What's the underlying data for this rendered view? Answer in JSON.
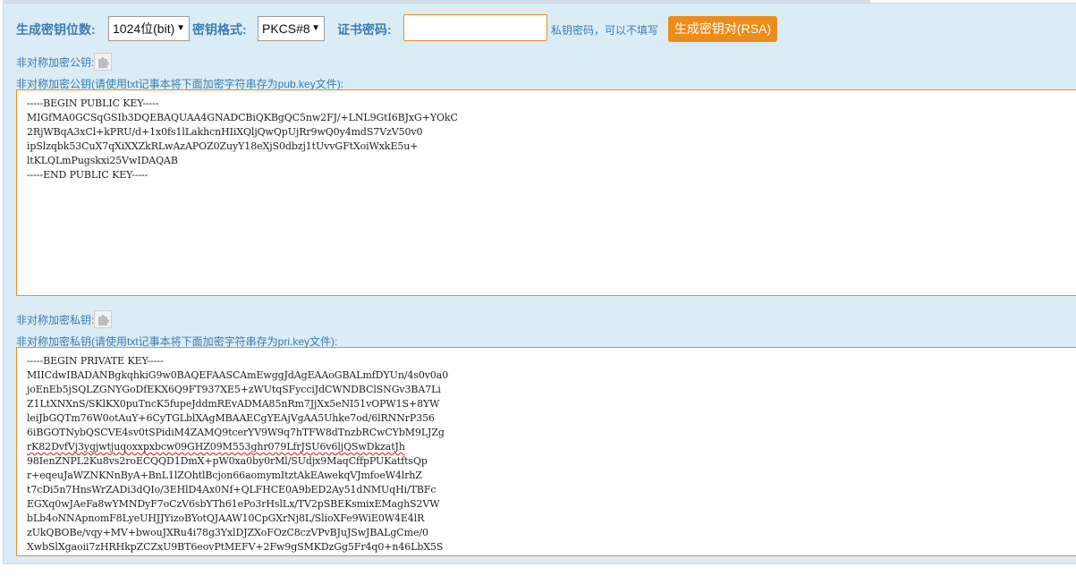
{
  "form": {
    "bits_label": "生成密钥位数:",
    "bits_value": "1024位(bit)",
    "format_label": "密钥格式:",
    "format_value": "PKCS#8",
    "password_label": "证书密码:",
    "password_value": "",
    "password_hint": "私钥密码，可以不填写",
    "generate_button": "生成密钥对(RSA)"
  },
  "public_key": {
    "label": "非对称加密公钥:",
    "instruction": "非对称加密公钥(请使用txt记事本将下面加密字符串存为pub.key文件):",
    "lines": [
      "-----BEGIN PUBLIC KEY-----",
      "MIGfMA0GCSqGSIb3DQEBAQUAA4GNADCBiQKBgQC5nw2FJ/+LNL9GtI6BJxG+YOkC",
      "2RjWBqA3xCl+kPRU/d+1x0fs1lLakhcnHIiXQljQwQpUjRr9wQ0y4mdS7VzV50v0",
      "ipSlzqbk53CuX7qXiXXZkRLwAzAPOZ0ZuyY18eXjS0dbzj1tUvvGFtXoiWxkE5u+",
      "ltKLQLmPugskxi25VwIDAQAB",
      "-----END PUBLIC KEY-----"
    ]
  },
  "private_key": {
    "label": "非对称加密私钥:",
    "instruction": "非对称加密私钥(请使用txt记事本将下面加密字符串存为pri.key文件):",
    "lines": [
      "-----BEGIN PRIVATE KEY-----",
      "MIICdwIBADANBgkqhkiG9w0BAQEFAASCAmEwggJdAgEAAoGBALmfDYUn/4s0v0a0",
      "joEnEb5jSQLZGNYGoDfEKX6Q9FT937XE5+zWUtqSFycciJdCWNDBClSNGv3BA7Li",
      "Z1LtXNXnS/SKlKX0puTncK5fupeJddmREvADMA85nRm7JjXx5eNI51vOPW1S+8YW",
      "leiJbGQTm76W0otAuY+6CyTGLblXAgMBAAECgYEAjVgAA5Uhke7od/6lRNNrP356",
      "6iBGOTNybQSCVE4sv0tSPidiM4ZAMQ9tcerYV9W9q7hTFW8dTnzbRCwCYbM9LJZg",
      "rK82DvfVj3ygjwtjuqoxxpxbcw09GHZ09M553ghr079LfrJSU6v6ljQSwDkzatJh",
      "98IenZNPL2Ku8vs2roECQQD1DmX+pW0xa0by0rMl/SUdjx9MaqCffpPUKatftsQp",
      "r+eqeuJaWZNKNnByA+BnL1lZOhtlBcjon66aomymItztAkEAwekqVJmfoeW4lrhZ",
      "t7cDi5n7HnsWrZADi3dQIo/3EHlD4Ax0Nf+QLFHCE0A9bED2Ay51dNMUqHi/TBFc",
      "EGXq0wJAeFa8wYMNDyF7oCzV6sbYTh61ePo3rHslLx/TV2pSBEKsmixEMaghS2VW",
      "bLb4oNNApnomF8LyeUHJJYizoBYotQJAAW10CpGXrNj8L/SlioXFe9WiE0W4E4lR",
      "zUkQBOBe/vqy+MV+bwouJXRu4i78g3YxlDJZXoFOzC8czVPvBJuJSwJBALgCme/0",
      "XwbSlXgaoii7zHRHkpZCZxU9BT6eovPtMEFV+2Fw9gSMKDzGg5Fr4q0+n46LbX5S"
    ]
  }
}
